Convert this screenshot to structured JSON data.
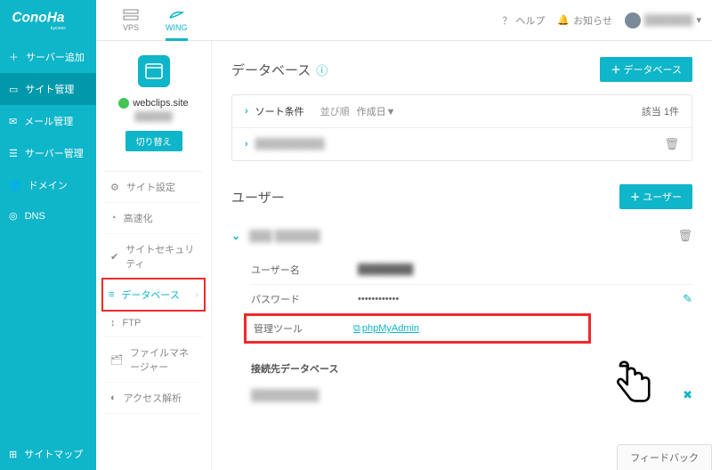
{
  "brand": "ConoHa",
  "brand_sub": "byGMO",
  "top_tabs": [
    {
      "id": "vps",
      "label": "VPS"
    },
    {
      "id": "wing",
      "label": "WING"
    }
  ],
  "top_right": {
    "help": "ヘルプ",
    "notice": "お知らせ",
    "user": "███████"
  },
  "sidebar": [
    {
      "id": "add-server",
      "label": "サーバー追加",
      "icon": "plus"
    },
    {
      "id": "site",
      "label": "サイト管理",
      "icon": "window",
      "active": true
    },
    {
      "id": "mail",
      "label": "メール管理",
      "icon": "envelope"
    },
    {
      "id": "server",
      "label": "サーバー管理",
      "icon": "server"
    },
    {
      "id": "domain",
      "label": "ドメイン",
      "icon": "globe"
    },
    {
      "id": "dns",
      "label": "DNS",
      "icon": "dns"
    }
  ],
  "sidebar_bottom": {
    "label": "サイトマップ"
  },
  "site_panel": {
    "name": "webclips.site",
    "sub": "██████",
    "switch": "切り替え"
  },
  "sub_menu": [
    {
      "id": "site-settings",
      "label": "サイト設定",
      "icon": "gear"
    },
    {
      "id": "speed",
      "label": "高速化",
      "icon": "gauge"
    },
    {
      "id": "security",
      "label": "サイトセキュリティ",
      "icon": "shield"
    },
    {
      "id": "database",
      "label": "データベース",
      "icon": "db",
      "active": true,
      "highlight": true
    },
    {
      "id": "ftp",
      "label": "FTP",
      "icon": "updown"
    },
    {
      "id": "file",
      "label": "ファイルマネージャー",
      "icon": "folder"
    },
    {
      "id": "access",
      "label": "アクセス解析",
      "icon": "chart"
    }
  ],
  "db": {
    "title": "データベース",
    "add": "データベース",
    "sort_label": "ソート条件",
    "sort_opt": "並び順",
    "sort_val": "作成日▼",
    "count": "該当 1件",
    "row_name": "██████████"
  },
  "user": {
    "title": "ユーザー",
    "add": "ユーザー",
    "name": "███ ██████",
    "fields": {
      "username_k": "ユーザー名",
      "username_v": "████████",
      "password_k": "パスワード",
      "password_v": "••••••••••••",
      "tool_k": "管理ツール",
      "tool_v": "phpMyAdmin"
    },
    "conn_title": "接続先データベース",
    "conn_name": "█████████"
  },
  "feedback": "フィードバック"
}
